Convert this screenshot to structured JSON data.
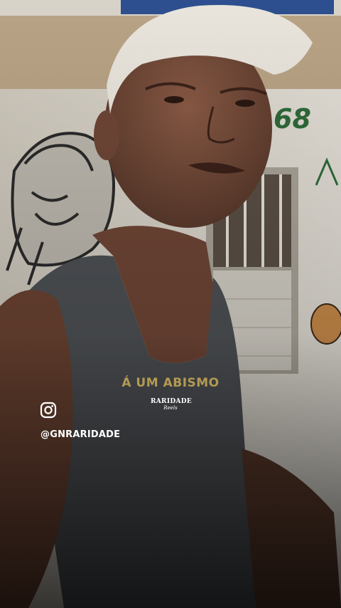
{
  "caption": {
    "text": "Á UM ABISMO"
  },
  "overlay": {
    "handle": "@GNRARIDADE",
    "social_icon": "instagram-icon",
    "logo_brand": "RARIDADE",
    "logo_sub": "Reels"
  },
  "wall": {
    "number": "68"
  },
  "colors": {
    "caption": "#b39a52",
    "handle": "#ffffff"
  }
}
